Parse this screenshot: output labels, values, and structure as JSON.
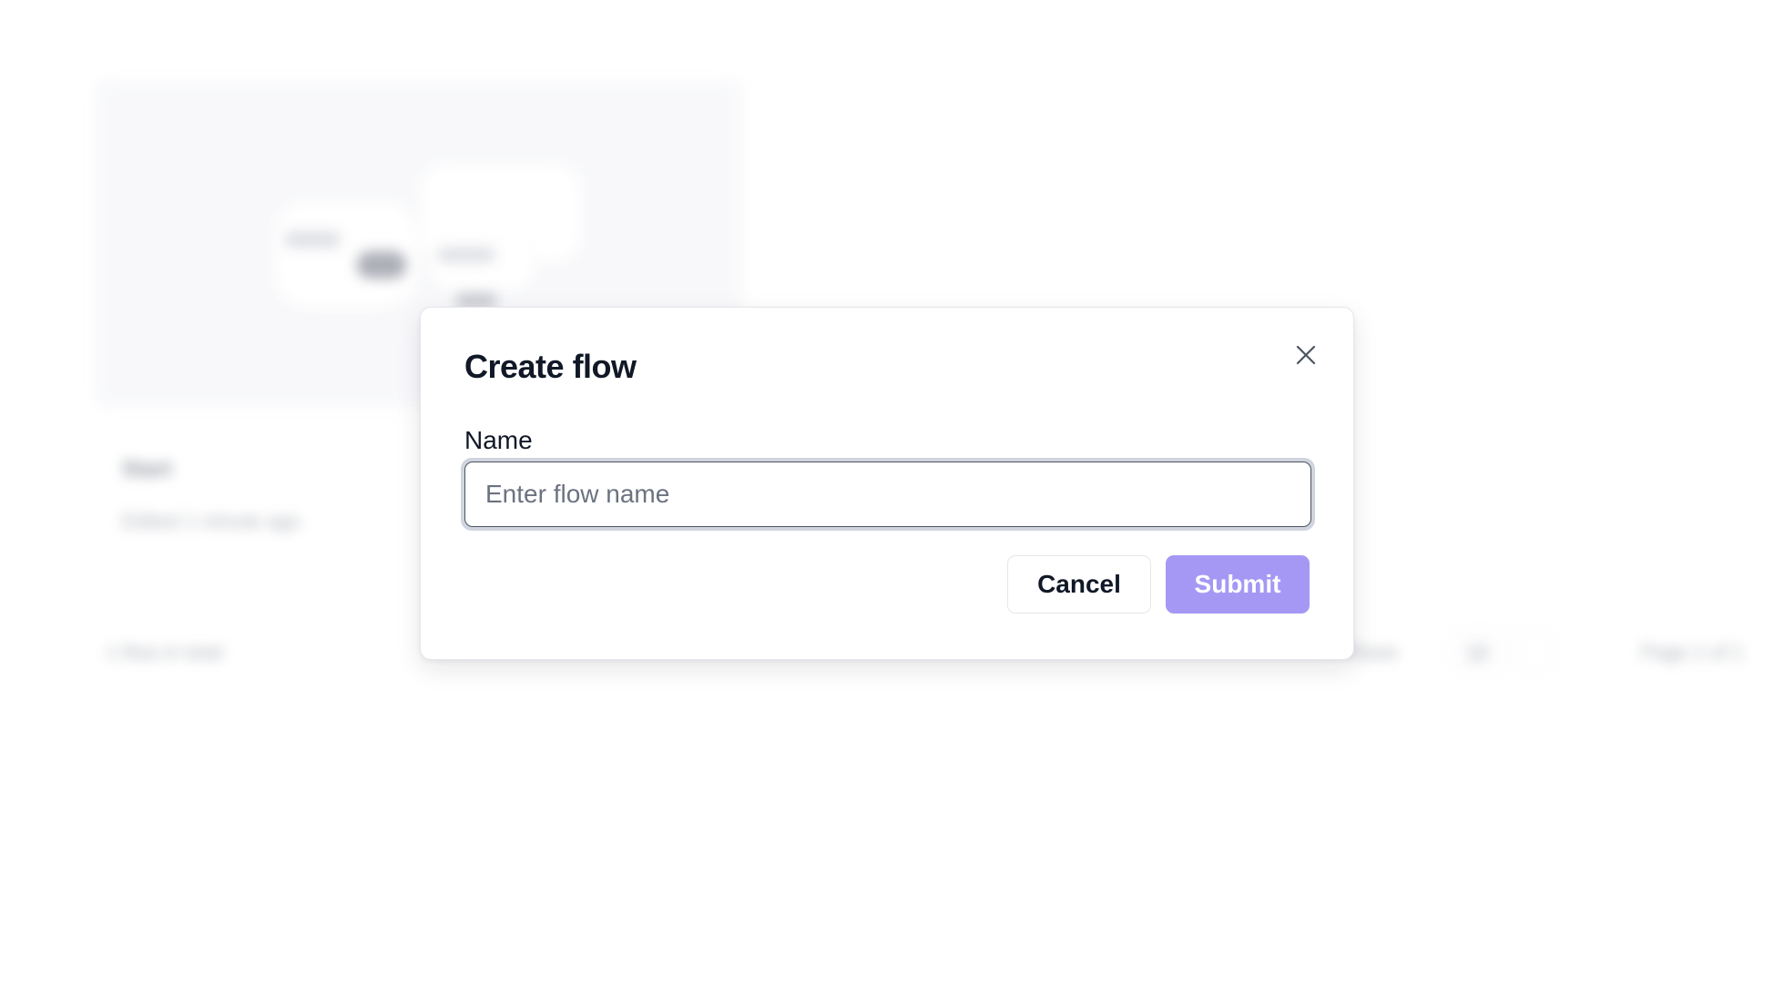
{
  "background": {
    "card_title": "Start",
    "card_subtitle": "Edited 1 minute ago",
    "footer_left": "1 flow in total",
    "footer_rows_label": "Rows",
    "footer_rows_value": "12",
    "footer_page": "Page 1 of 1"
  },
  "dialog": {
    "title": "Create flow",
    "close_icon": "close-icon",
    "name_label": "Name",
    "name_value": "",
    "name_placeholder": "Enter flow name",
    "cancel_label": "Cancel",
    "submit_label": "Submit",
    "submit_disabled": true
  },
  "colors": {
    "accent": "#a598f5",
    "text": "#111827",
    "placeholder": "#6b7280",
    "border": "#e5e7eb"
  }
}
